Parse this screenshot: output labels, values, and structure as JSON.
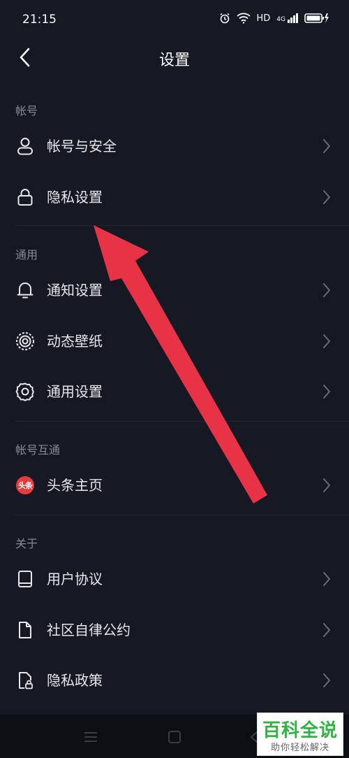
{
  "status_bar": {
    "time": "21:15",
    "network": "HD",
    "signal_gen": "4G"
  },
  "header": {
    "title": "设置"
  },
  "sections": {
    "account": {
      "header": "帐号",
      "items": [
        {
          "label": "帐号与安全",
          "icon": "user-icon"
        },
        {
          "label": "隐私设置",
          "icon": "lock-icon"
        }
      ]
    },
    "general": {
      "header": "通用",
      "items": [
        {
          "label": "通知设置",
          "icon": "bell-icon"
        },
        {
          "label": "动态壁纸",
          "icon": "live-wallpaper-icon"
        },
        {
          "label": "通用设置",
          "icon": "gear-icon"
        }
      ]
    },
    "interop": {
      "header": "帐号互通",
      "items": [
        {
          "label": "头条主页",
          "icon": "toutiao-icon",
          "badge": "头条"
        }
      ]
    },
    "about": {
      "header": "关于",
      "items": [
        {
          "label": "用户协议",
          "icon": "book-icon"
        },
        {
          "label": "社区自律公约",
          "icon": "document-icon"
        },
        {
          "label": "隐私政策",
          "icon": "privacy-document-icon"
        }
      ]
    }
  },
  "watermark": {
    "title": "百科全说",
    "subtitle": "助你轻松解决"
  },
  "colors": {
    "background": "#161823",
    "arrow": "#e83347",
    "watermark_green": "#2fb440"
  }
}
